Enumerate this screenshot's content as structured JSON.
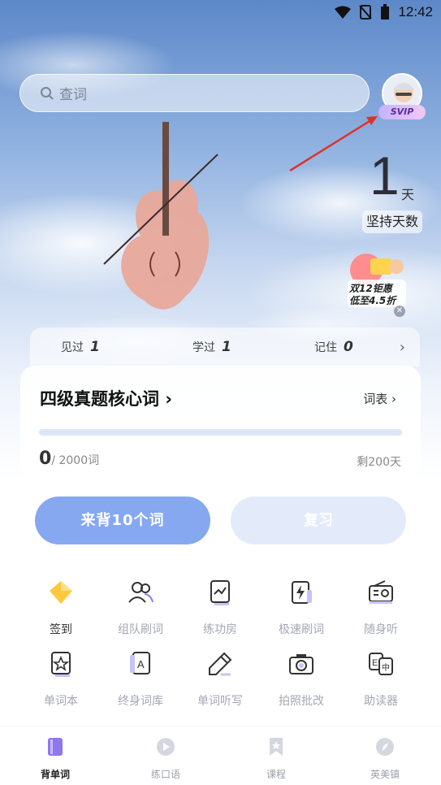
{
  "status_bar": {
    "time": "12:42"
  },
  "search": {
    "placeholder": "查词"
  },
  "profile": {
    "badge": "SVIP"
  },
  "streak": {
    "days": "1",
    "unit": "天",
    "label": "坚持天数"
  },
  "promo": {
    "line1": "双12钜惠",
    "line2": "低至4.5折"
  },
  "stats": [
    {
      "label": "见过",
      "value": "1"
    },
    {
      "label": "学过",
      "value": "1"
    },
    {
      "label": "记住",
      "value": "0"
    }
  ],
  "book": {
    "title": "四级真题核心词",
    "wordlist_label": "词表",
    "learned": "0",
    "total": "/ 2000词",
    "remaining": "剩200天",
    "progress_fraction": 0
  },
  "actions": {
    "learn": "来背10个词",
    "review": "复习"
  },
  "tools": [
    {
      "label": "签到",
      "icon": "diamond-icon"
    },
    {
      "label": "组队刷词",
      "icon": "team-icon"
    },
    {
      "label": "练功房",
      "icon": "chart-card-icon"
    },
    {
      "label": "极速刷词",
      "icon": "lightning-card-icon"
    },
    {
      "label": "随身听",
      "icon": "radio-icon"
    },
    {
      "label": "单词本",
      "icon": "star-card-icon"
    },
    {
      "label": "终身词库",
      "icon": "letter-card-icon"
    },
    {
      "label": "单词听写",
      "icon": "pencil-icon"
    },
    {
      "label": "拍照批改",
      "icon": "camera-icon"
    },
    {
      "label": "助读器",
      "icon": "translate-icon"
    }
  ],
  "nav": [
    {
      "label": "背单词",
      "icon": "book-icon"
    },
    {
      "label": "练口语",
      "icon": "play-icon"
    },
    {
      "label": "课程",
      "icon": "bookmark-icon"
    },
    {
      "label": "英美镇",
      "icon": "compass-icon"
    }
  ],
  "colors": {
    "accent": "#86a8f0",
    "accent_light": "#e3ebfb",
    "active_text": "#333333",
    "muted": "#a3a7b3"
  }
}
